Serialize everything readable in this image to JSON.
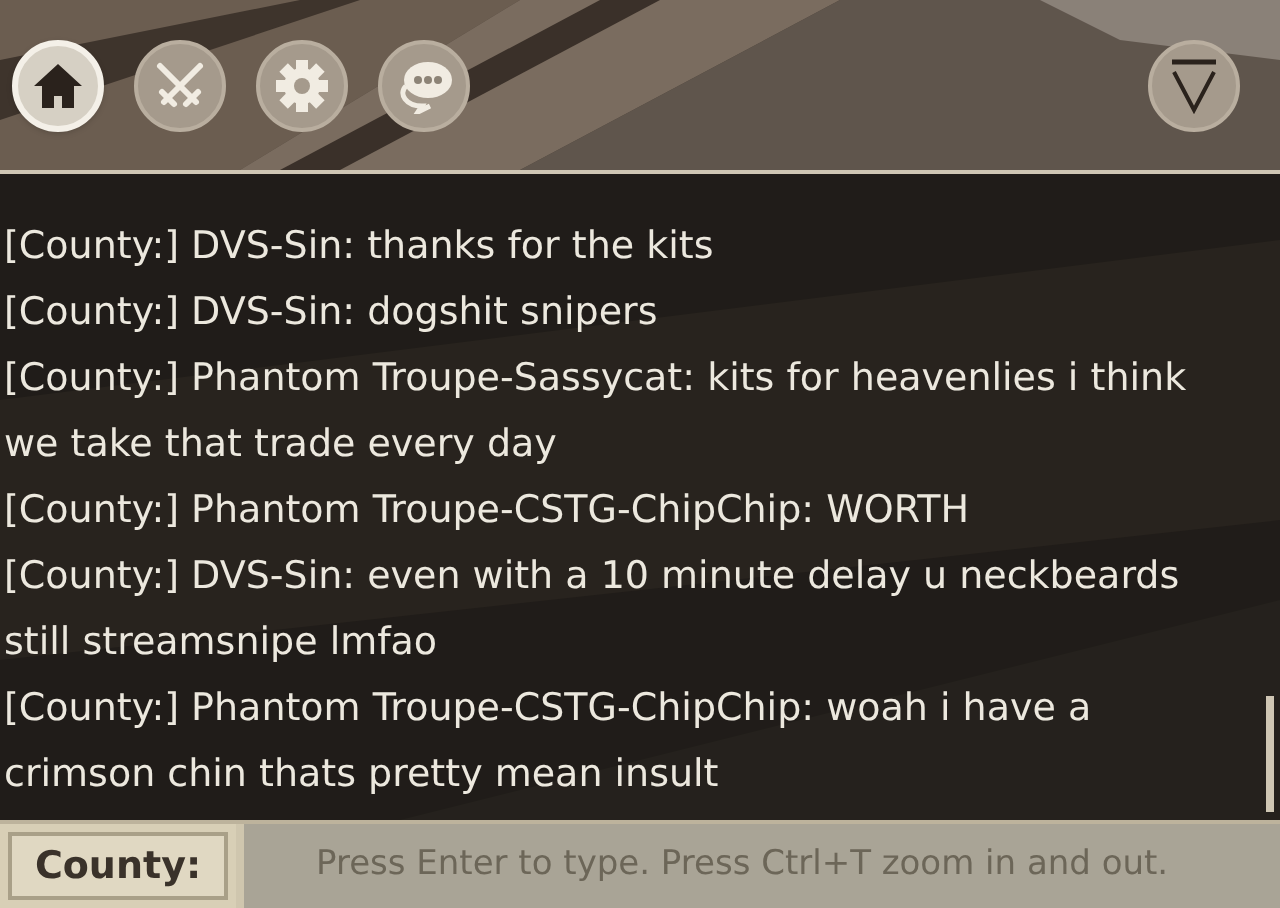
{
  "toolbar": [
    {
      "kind": "home",
      "selected": true
    },
    {
      "kind": "swords",
      "selected": false
    },
    {
      "kind": "gear",
      "selected": false
    },
    {
      "kind": "chat",
      "selected": false
    }
  ],
  "collapse_button": {
    "kind": "triangle"
  },
  "messages": [
    {
      "text": "[County:] DVS-Sin: thanks for the kits"
    },
    {
      "text": "[County:] DVS-Sin: dogshit snipers"
    },
    {
      "text": "[County:] Phantom Troupe-Sassycat: kits for heavenlies i think we take that trade every day"
    },
    {
      "text": "[County:] Phantom Troupe-CSTG-ChipChip: WORTH"
    },
    {
      "text": "[County:] DVS-Sin: even with a 10 minute delay u neckbeards still streamsnipe lmfao"
    },
    {
      "text": "[County:] Phantom Troupe-CSTG-ChipChip: woah i have a crimson chin thats pretty mean insult"
    }
  ],
  "input": {
    "channel": "County:",
    "placeholder": "Press Enter to type. Press Ctrl+T zoom in and out."
  }
}
